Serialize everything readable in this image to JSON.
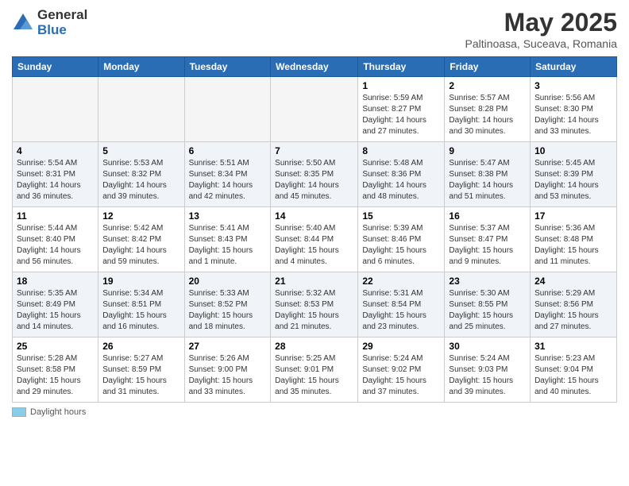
{
  "logo": {
    "general": "General",
    "blue": "Blue"
  },
  "title": "May 2025",
  "subtitle": "Paltinoasa, Suceava, Romania",
  "days_header": [
    "Sunday",
    "Monday",
    "Tuesday",
    "Wednesday",
    "Thursday",
    "Friday",
    "Saturday"
  ],
  "footer_label": "Daylight hours",
  "weeks": [
    [
      {
        "day": "",
        "info": ""
      },
      {
        "day": "",
        "info": ""
      },
      {
        "day": "",
        "info": ""
      },
      {
        "day": "",
        "info": ""
      },
      {
        "day": "1",
        "info": "Sunrise: 5:59 AM\nSunset: 8:27 PM\nDaylight: 14 hours and 27 minutes."
      },
      {
        "day": "2",
        "info": "Sunrise: 5:57 AM\nSunset: 8:28 PM\nDaylight: 14 hours and 30 minutes."
      },
      {
        "day": "3",
        "info": "Sunrise: 5:56 AM\nSunset: 8:30 PM\nDaylight: 14 hours and 33 minutes."
      }
    ],
    [
      {
        "day": "4",
        "info": "Sunrise: 5:54 AM\nSunset: 8:31 PM\nDaylight: 14 hours and 36 minutes."
      },
      {
        "day": "5",
        "info": "Sunrise: 5:53 AM\nSunset: 8:32 PM\nDaylight: 14 hours and 39 minutes."
      },
      {
        "day": "6",
        "info": "Sunrise: 5:51 AM\nSunset: 8:34 PM\nDaylight: 14 hours and 42 minutes."
      },
      {
        "day": "7",
        "info": "Sunrise: 5:50 AM\nSunset: 8:35 PM\nDaylight: 14 hours and 45 minutes."
      },
      {
        "day": "8",
        "info": "Sunrise: 5:48 AM\nSunset: 8:36 PM\nDaylight: 14 hours and 48 minutes."
      },
      {
        "day": "9",
        "info": "Sunrise: 5:47 AM\nSunset: 8:38 PM\nDaylight: 14 hours and 51 minutes."
      },
      {
        "day": "10",
        "info": "Sunrise: 5:45 AM\nSunset: 8:39 PM\nDaylight: 14 hours and 53 minutes."
      }
    ],
    [
      {
        "day": "11",
        "info": "Sunrise: 5:44 AM\nSunset: 8:40 PM\nDaylight: 14 hours and 56 minutes."
      },
      {
        "day": "12",
        "info": "Sunrise: 5:42 AM\nSunset: 8:42 PM\nDaylight: 14 hours and 59 minutes."
      },
      {
        "day": "13",
        "info": "Sunrise: 5:41 AM\nSunset: 8:43 PM\nDaylight: 15 hours and 1 minute."
      },
      {
        "day": "14",
        "info": "Sunrise: 5:40 AM\nSunset: 8:44 PM\nDaylight: 15 hours and 4 minutes."
      },
      {
        "day": "15",
        "info": "Sunrise: 5:39 AM\nSunset: 8:46 PM\nDaylight: 15 hours and 6 minutes."
      },
      {
        "day": "16",
        "info": "Sunrise: 5:37 AM\nSunset: 8:47 PM\nDaylight: 15 hours and 9 minutes."
      },
      {
        "day": "17",
        "info": "Sunrise: 5:36 AM\nSunset: 8:48 PM\nDaylight: 15 hours and 11 minutes."
      }
    ],
    [
      {
        "day": "18",
        "info": "Sunrise: 5:35 AM\nSunset: 8:49 PM\nDaylight: 15 hours and 14 minutes."
      },
      {
        "day": "19",
        "info": "Sunrise: 5:34 AM\nSunset: 8:51 PM\nDaylight: 15 hours and 16 minutes."
      },
      {
        "day": "20",
        "info": "Sunrise: 5:33 AM\nSunset: 8:52 PM\nDaylight: 15 hours and 18 minutes."
      },
      {
        "day": "21",
        "info": "Sunrise: 5:32 AM\nSunset: 8:53 PM\nDaylight: 15 hours and 21 minutes."
      },
      {
        "day": "22",
        "info": "Sunrise: 5:31 AM\nSunset: 8:54 PM\nDaylight: 15 hours and 23 minutes."
      },
      {
        "day": "23",
        "info": "Sunrise: 5:30 AM\nSunset: 8:55 PM\nDaylight: 15 hours and 25 minutes."
      },
      {
        "day": "24",
        "info": "Sunrise: 5:29 AM\nSunset: 8:56 PM\nDaylight: 15 hours and 27 minutes."
      }
    ],
    [
      {
        "day": "25",
        "info": "Sunrise: 5:28 AM\nSunset: 8:58 PM\nDaylight: 15 hours and 29 minutes."
      },
      {
        "day": "26",
        "info": "Sunrise: 5:27 AM\nSunset: 8:59 PM\nDaylight: 15 hours and 31 minutes."
      },
      {
        "day": "27",
        "info": "Sunrise: 5:26 AM\nSunset: 9:00 PM\nDaylight: 15 hours and 33 minutes."
      },
      {
        "day": "28",
        "info": "Sunrise: 5:25 AM\nSunset: 9:01 PM\nDaylight: 15 hours and 35 minutes."
      },
      {
        "day": "29",
        "info": "Sunrise: 5:24 AM\nSunset: 9:02 PM\nDaylight: 15 hours and 37 minutes."
      },
      {
        "day": "30",
        "info": "Sunrise: 5:24 AM\nSunset: 9:03 PM\nDaylight: 15 hours and 39 minutes."
      },
      {
        "day": "31",
        "info": "Sunrise: 5:23 AM\nSunset: 9:04 PM\nDaylight: 15 hours and 40 minutes."
      }
    ]
  ]
}
